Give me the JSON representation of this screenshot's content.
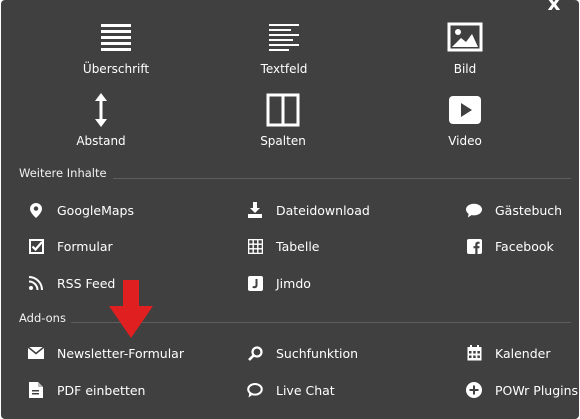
{
  "close_label": "x",
  "top_items": [
    {
      "label": "Überschrift",
      "icon": "heading-icon"
    },
    {
      "label": "Textfeld",
      "icon": "text-icon"
    },
    {
      "label": "Bild",
      "icon": "image-icon"
    },
    {
      "label": "Abstand",
      "icon": "spacing-icon"
    },
    {
      "label": "Spalten",
      "icon": "columns-icon"
    },
    {
      "label": "Video",
      "icon": "video-play-icon"
    }
  ],
  "sections": {
    "more": {
      "title": "Weitere Inhalte",
      "items": [
        {
          "label": "GoogleMaps",
          "icon": "map-pin-icon"
        },
        {
          "label": "Dateidownload",
          "icon": "download-icon"
        },
        {
          "label": "Gästebuch",
          "icon": "speech-bubble-icon"
        },
        {
          "label": "Formular",
          "icon": "checkbox-form-icon"
        },
        {
          "label": "Tabelle",
          "icon": "table-icon"
        },
        {
          "label": "Facebook",
          "icon": "facebook-icon"
        },
        {
          "label": "RSS Feed",
          "icon": "rss-icon"
        },
        {
          "label": "Jimdo",
          "icon": "jimdo-icon"
        }
      ]
    },
    "addons": {
      "title": "Add-ons",
      "items": [
        {
          "label": "Newsletter-Formular",
          "icon": "envelope-icon"
        },
        {
          "label": "Suchfunktion",
          "icon": "search-icon"
        },
        {
          "label": "Kalender",
          "icon": "calendar-icon"
        },
        {
          "label": "PDF einbetten",
          "icon": "pdf-document-icon"
        },
        {
          "label": "Live Chat",
          "icon": "chat-icon"
        },
        {
          "label": "POWr Plugins",
          "icon": "plus-circle-icon"
        }
      ]
    }
  },
  "colors": {
    "panel_bg": "#404040",
    "text": "#ffffff",
    "arrow": "#e02020"
  }
}
